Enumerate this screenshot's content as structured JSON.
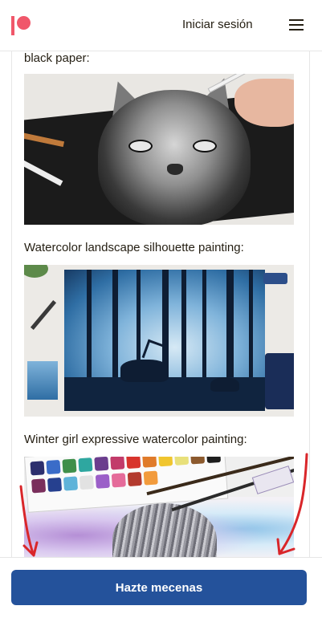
{
  "header": {
    "logo": "patreon-logo",
    "login_label": "Iniciar sesión",
    "menu_icon": "hamburger-menu-icon"
  },
  "post": {
    "captions": [
      "black paper:",
      "Watercolor landscape silhouette painting:",
      "Winter girl expressive watercolor painting:"
    ],
    "images": [
      "cat-drawing-on-black-paper",
      "watercolor-forest-silhouette",
      "winter-girl-watercolor"
    ]
  },
  "annotations": {
    "color": "#d9262a",
    "count": 2
  },
  "footer": {
    "cta_label": "Hazte mecenas",
    "cta_color": "#24529b"
  },
  "colors": {
    "brand": "#f0576a",
    "text": "#241e12",
    "divider": "#e6e6e6"
  }
}
